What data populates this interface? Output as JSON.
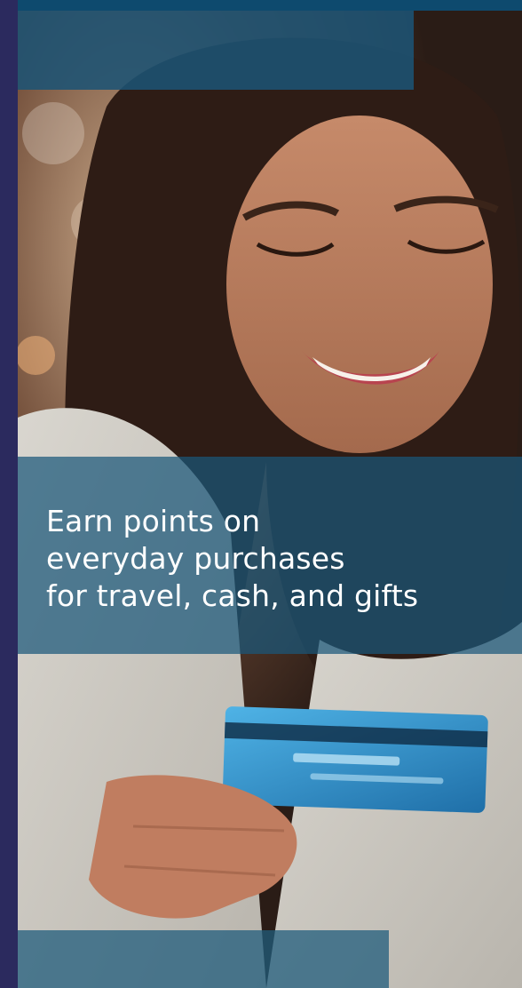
{
  "promo": {
    "headline_lines": [
      "Earn points on",
      "everyday purchases",
      "for travel, cash, and gifts"
    ]
  },
  "images": {
    "hero": "woman-smiling-holding-credit-card-photo"
  },
  "colors": {
    "panel_blue": "#1c5374",
    "band_blue": "#1b587a",
    "edge_navy": "#2b2a5e",
    "card_blue": "#2f8fc4",
    "text_white": "#ffffff"
  }
}
